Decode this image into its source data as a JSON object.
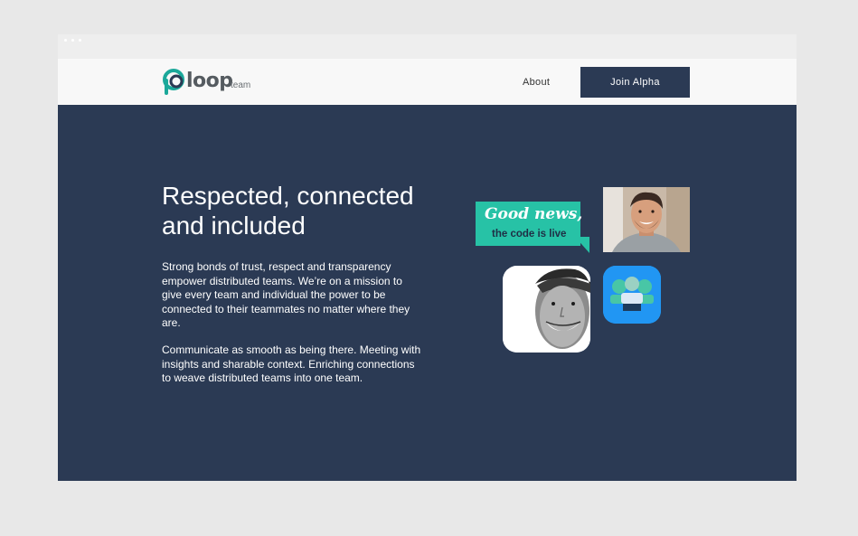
{
  "brand": {
    "name": "loop",
    "sub": "team",
    "colors": {
      "logo_teal": "#1ba89a",
      "logo_dark": "#2b3a54",
      "text_gray": "#555b60"
    }
  },
  "nav": {
    "about_label": "About",
    "cta_label": "Join Alpha",
    "cta_color": "#2b3a54"
  },
  "hero": {
    "title_line1": "Respected, connected",
    "title_line2": "and included",
    "paragraph1": "Strong bonds of trust, respect and transparency empower distributed teams. We’re on a mission to give every team and individual the power to be connected to their teammates no matter where they are.",
    "paragraph2": "Communicate as smooth as being there. Meeting with insights and sharable context. Enriching connections to weave distributed teams into one team.",
    "background": "#2b3a54"
  },
  "illustration": {
    "bubble_line1": "Good news,",
    "bubble_line2": "the code is live",
    "bubble_color": "#27c2a6",
    "app_icon": "team-app-icon",
    "app_icon_color": "#2196f3"
  }
}
